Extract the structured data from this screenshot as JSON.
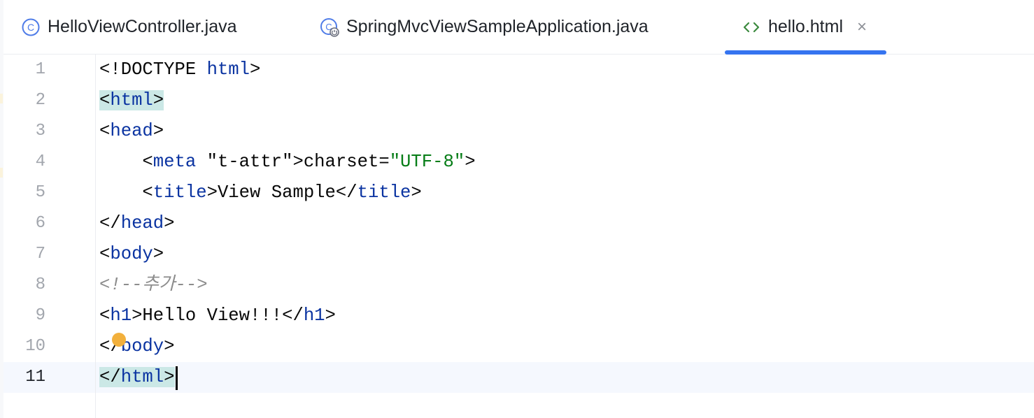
{
  "tabs": [
    {
      "label": "HelloViewController.java",
      "icon": "java-class-icon",
      "active": false
    },
    {
      "label": "SpringMvcViewSampleApplication.java",
      "icon": "spring-boot-class-icon",
      "active": false
    },
    {
      "label": "hello.html",
      "icon": "html-file-icon",
      "active": true,
      "close_glyph": "×"
    }
  ],
  "editor": {
    "file": "hello.html",
    "current_line": 11,
    "lines": [
      {
        "no": "1",
        "code": "<!DOCTYPE html>"
      },
      {
        "no": "2",
        "code": "<html>"
      },
      {
        "no": "3",
        "code": "<head>"
      },
      {
        "no": "4",
        "code": "    <meta charset=\"UTF-8\">"
      },
      {
        "no": "5",
        "code": "    <title>View Sample</title>"
      },
      {
        "no": "6",
        "code": "</head>"
      },
      {
        "no": "7",
        "code": "<body>"
      },
      {
        "no": "8",
        "code": "<!--추가-->"
      },
      {
        "no": "9",
        "code": "<h1>Hello View!!!</h1>"
      },
      {
        "no": "10",
        "code": "</body>"
      },
      {
        "no": "11",
        "code": "</html>"
      }
    ]
  },
  "colors": {
    "accent": "#3574f0",
    "tag": "#0a33a1",
    "attribute": "#1750eb",
    "string": "#067d17",
    "comment": "#8c8c8c",
    "brace_match": "#cbe8e6",
    "current_line": "#f5f8fe",
    "intention_bulb": "#f2b03c"
  }
}
